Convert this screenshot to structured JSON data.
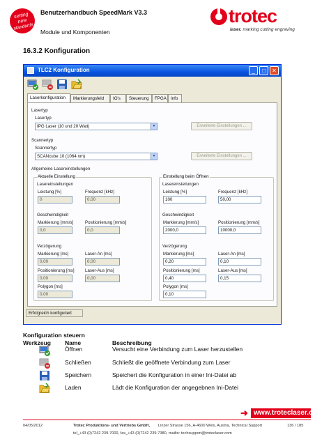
{
  "header": {
    "title": "Benutzerhandbuch SpeedMark V3.3",
    "subtitle": "Module und Komponenten",
    "badge_text": "setting new standards",
    "logo": {
      "word": "trotec",
      "tag_bold": "laser.",
      "tag_rest": "marking cutting engraving"
    }
  },
  "section_title": "16.3.2  Konfiguration",
  "dialog": {
    "title": "TLC2 Konfiguration",
    "toolbar_icons": [
      "connect-icon",
      "disconnect-icon",
      "save-icon",
      "load-icon"
    ],
    "tabs": [
      "Laserkonfiguration",
      "Markierungsfeld",
      "IO's",
      "Steuerung",
      "FPGA",
      "Info"
    ],
    "lasertyp_group": "Lasertyp",
    "lasertyp_label": "Lasertyp",
    "lasertyp_value": "IPG Laser (10 und 20 Watt)",
    "erweiterte_btn_1": "Erweiterte Einstellungen ...",
    "scannertyp_group": "Scannertyp",
    "scannertyp_label": "Scannertyp",
    "scannertyp_value": "SCANcube 10 (1064 nm)",
    "erweiterte_btn_2": "Erweiterte Einstellungen ...",
    "allgemein_group": "Allgemeine Lasereinstellungen",
    "aktuell": {
      "title": "Aktuelle Einstellung",
      "laser_group": "Lasereinstellungen",
      "leistung_label": "Leistung [%]",
      "leistung": "0",
      "frequenz_label": "Frequenz [kHz]",
      "frequenz": "0,00",
      "geschw_group": "Geschwindigkeit",
      "markierung_label": "Markierung [mm/s]",
      "markierung": "0,0",
      "positionierung_label": "Positionierung [mm/s]",
      "positionierung": "0,0",
      "verz_group": "Verzögerung",
      "vmark_label": "Markierung [ms]",
      "vmark": "0,00",
      "laser_an_label": "Laser-An [ms]",
      "laser_an": "0,00",
      "vpos_label": "Positionierung [ms]",
      "vpos": "0,00",
      "laser_aus_label": "Laser-Aus [ms]",
      "laser_aus": "0,00",
      "polygon_label": "Polygon [ms]",
      "polygon": "0,00"
    },
    "oeffnen": {
      "title": "Einstellung beim Öffnen",
      "laser_group": "Lasereinstellungen",
      "leistung_label": "Leistung [%]",
      "leistung": "100",
      "frequenz_label": "Frequenz [kHz]",
      "frequenz": "50,00",
      "geschw_group": "Geschwindigkeit",
      "markierung_label": "Markierung [mm/s]",
      "markierung": "2000,0",
      "positionierung_label": "Positionierung [mm/s]",
      "positionierung": "10000,0",
      "verz_group": "Verzögerung",
      "vmark_label": "Markierung [ms]",
      "vmark": "0,20",
      "laser_an_label": "Laser-An [ms]",
      "laser_an": "0,10",
      "vpos_label": "Positionierung [ms]",
      "vpos": "0,40",
      "laser_aus_label": "Laser-Aus [ms]",
      "laser_aus": "0,15",
      "polygon_label": "Polygon [ms]",
      "polygon": "0,10"
    },
    "status": "Erfolgreich konfiguriert"
  },
  "steuern": {
    "heading": "Konfiguration steuern",
    "col_werkzeug": "Werkzeug",
    "col_name": "Name",
    "col_beschreibung": "Beschreibung",
    "rows": [
      {
        "icon": "connect-icon",
        "name": "Öffnen",
        "desc": "Versucht eine Verbindung zum Laser herzustellen"
      },
      {
        "icon": "disconnect-icon",
        "name": "Schließen",
        "desc": "Schließt die geöffnete Verbindung zum Laser"
      },
      {
        "icon": "save-icon",
        "name": "Speichern",
        "desc": "Speichert die Konfiguration in einer Ini-Datei ab"
      },
      {
        "icon": "load-icon",
        "name": "Laden",
        "desc": "Lädt die Konfiguration der angegebnen Ini-Datei"
      }
    ]
  },
  "footer": {
    "url": "www.troteclaser.com",
    "date": "04/05/2012",
    "company": "Trotec Produktions- und Vertriebs GmbH,",
    "address": "Linzer Strasse 156, A-4600 Wels, Austria, Technical Support",
    "page": "136 / 185",
    "contact": "tel_+43 (0)7242 239-7000, fax_+43 (0)7242 239-7380, mailto: techsupport@troteclaser.com"
  },
  "colors": {
    "brand_red": "#e2001a",
    "titlebar_blue": "#0a54e0",
    "dialog_bg": "#ece9d8"
  }
}
